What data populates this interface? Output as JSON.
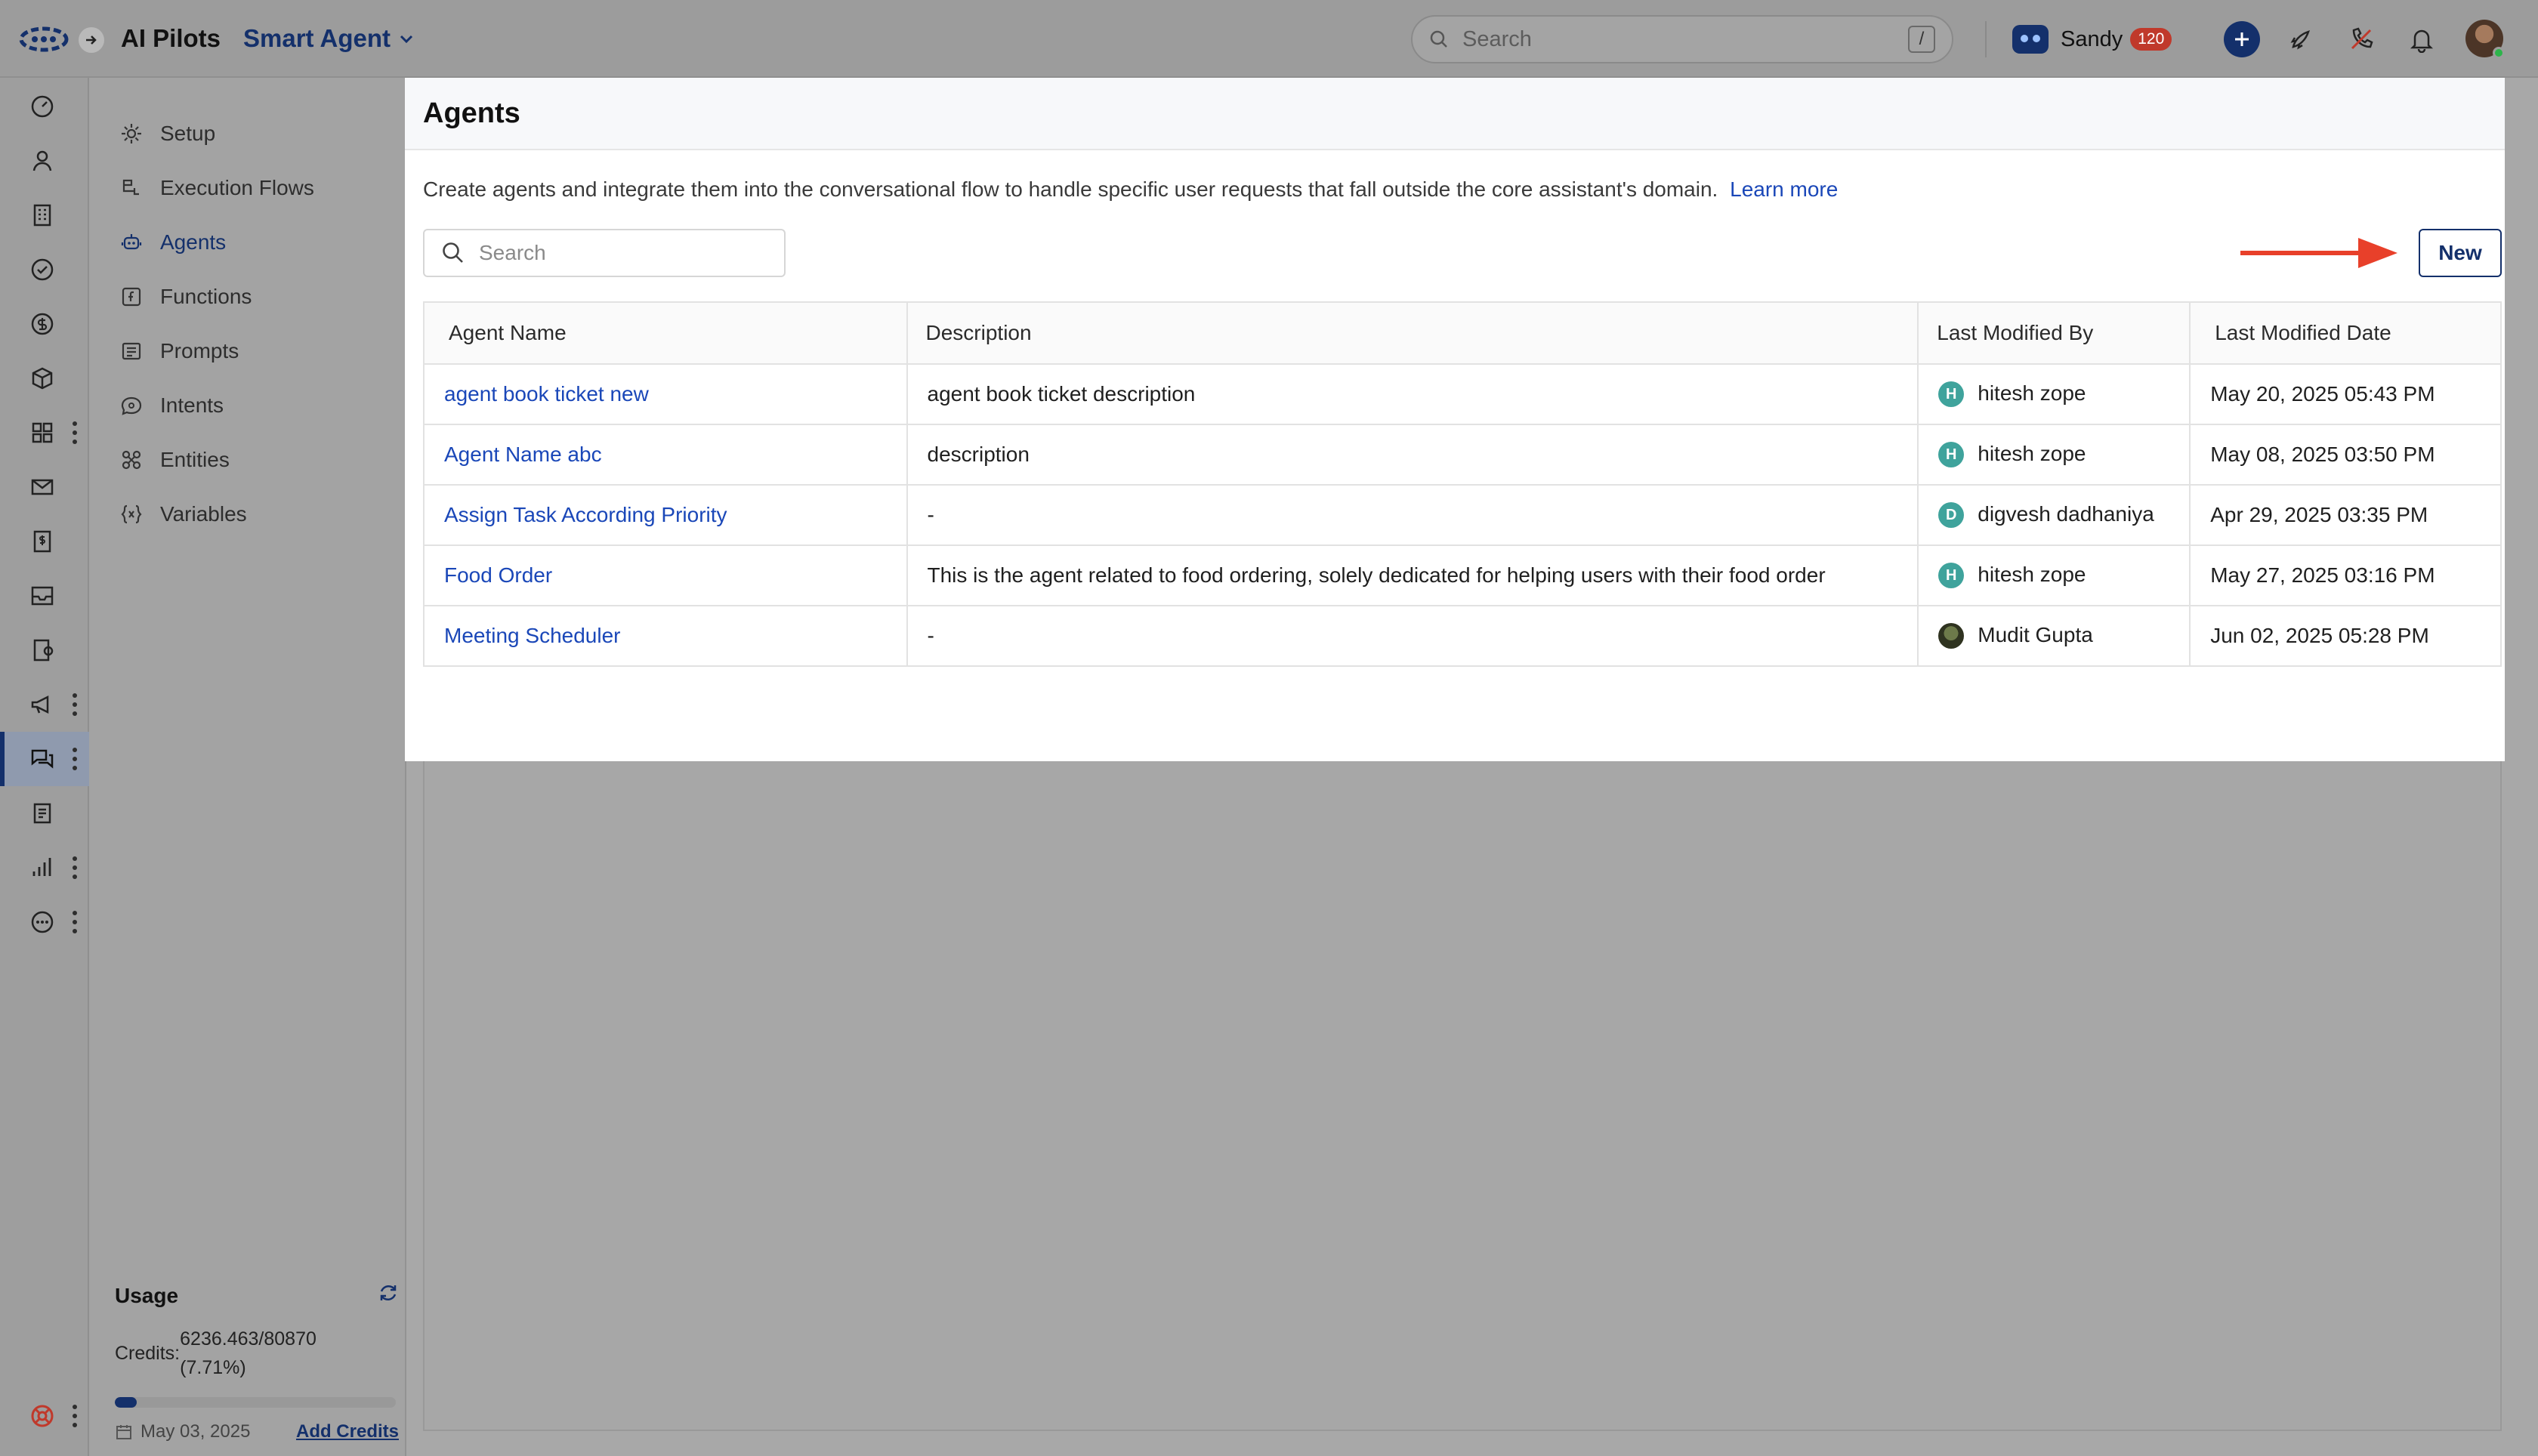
{
  "topbar": {
    "app_name": "AI Pilots",
    "module_name": "Smart Agent",
    "search_placeholder": "Search",
    "search_shortcut": "/",
    "user_name": "Sandy",
    "notification_count": "120"
  },
  "subnav": {
    "items": [
      {
        "label": "Setup",
        "icon": "gear-icon"
      },
      {
        "label": "Execution Flows",
        "icon": "flow-icon"
      },
      {
        "label": "Agents",
        "icon": "agent-icon",
        "active": true
      },
      {
        "label": "Functions",
        "icon": "function-icon"
      },
      {
        "label": "Prompts",
        "icon": "prompt-icon"
      },
      {
        "label": "Intents",
        "icon": "intent-icon"
      },
      {
        "label": "Entities",
        "icon": "entities-icon"
      },
      {
        "label": "Variables",
        "icon": "variables-icon"
      }
    ]
  },
  "usage": {
    "title": "Usage",
    "credits_label": "Credits:",
    "credits_value": "6236.463/80870",
    "credits_percent": "(7.71%)",
    "progress_fraction": 0.0771,
    "date": "May 03, 2025",
    "add_credits": "Add Credits"
  },
  "panel": {
    "title": "Agents",
    "description": "Create agents and integrate them into the conversational flow to handle specific user requests that fall outside the core assistant's domain.",
    "learn_more": "Learn more",
    "search_placeholder": "Search",
    "new_button": "New",
    "columns": [
      "Agent Name",
      "Description",
      "Last Modified By",
      "Last Modified Date"
    ],
    "rows": [
      {
        "name": "agent book ticket new",
        "description": "agent book ticket description",
        "initial": "H",
        "by": "hitesh zope",
        "date": "May 20, 2025 05:43 PM"
      },
      {
        "name": "Agent Name abc",
        "description": "description",
        "initial": "H",
        "by": "hitesh zope",
        "date": "May 08, 2025 03:50 PM"
      },
      {
        "name": "Assign Task According Priority",
        "description": "-",
        "initial": "D",
        "by": "digvesh dadhaniya",
        "date": "Apr 29, 2025 03:35 PM"
      },
      {
        "name": "Food Order",
        "description": "This is the agent related to food ordering, solely dedicated for helping users with their food order",
        "initial": "H",
        "by": "hitesh zope",
        "date": "May 27, 2025 03:16 PM"
      },
      {
        "name": "Meeting Scheduler",
        "description": "-",
        "initial": "",
        "by": "Mudit Gupta",
        "date": "Jun 02, 2025 05:28 PM"
      }
    ]
  },
  "colors": {
    "brand": "#14306b",
    "link": "#1a47b8",
    "arrow": "#e8402a",
    "badge": "#c0392b"
  }
}
